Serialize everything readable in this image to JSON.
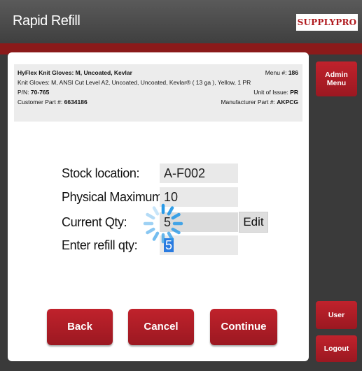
{
  "header": {
    "title": "Rapid Refill",
    "logo_text": "SUPPLYPRO"
  },
  "product": {
    "name": "HyFlex Knit Gloves: M, Uncoated, Kevlar",
    "menu_label": "Menu #:",
    "menu_number": "186",
    "description": "Knit Gloves: M, ANSI Cut Level A2, Uncoated, Uncoated, Kevlar® ( 13 ga ), Yellow, 1 PR",
    "pn_label": "P/N:",
    "pn": "70-765",
    "unit_label": "Unit of Issue:",
    "unit": "PR",
    "customer_part_label": "Customer Part #:",
    "customer_part": "6634186",
    "manufacturer_part_label": "Manufacturer Part #:",
    "manufacturer_part": "AKPCG"
  },
  "form": {
    "stock_location_label": "Stock location:",
    "stock_location_value": "A-F002",
    "physical_max_label": "Physical Maximum:",
    "physical_max_value": "10",
    "current_qty_label": "Current Qty:",
    "current_qty_value": "5",
    "edit_label": "Edit",
    "refill_label": "Enter refill qty:",
    "refill_value": "5"
  },
  "buttons": {
    "back": "Back",
    "cancel": "Cancel",
    "continue": "Continue"
  },
  "sidebar": {
    "admin_line1": "Admin",
    "admin_line2": "Menu",
    "user": "User",
    "logout": "Logout"
  },
  "colors": {
    "accent_red": "#b0191e",
    "header_bg": "#4a4a4a",
    "selection_blue": "#2a7be0"
  }
}
